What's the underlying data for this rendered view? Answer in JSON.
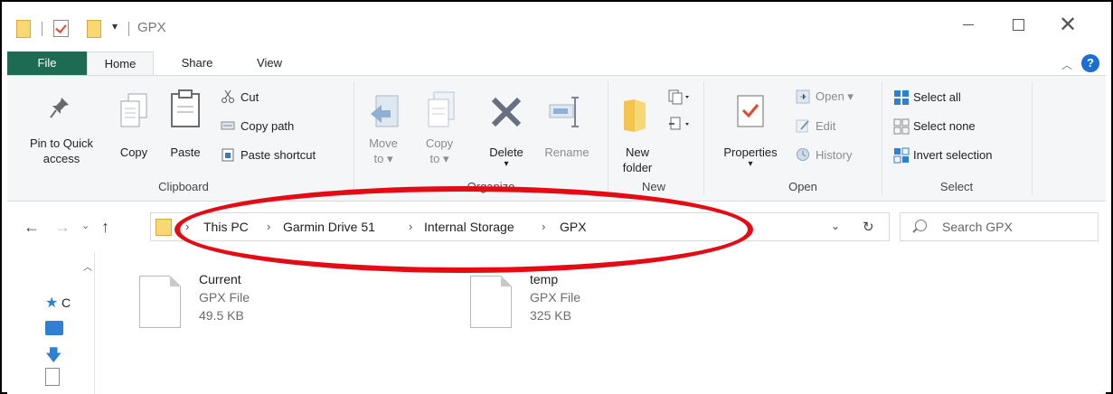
{
  "window": {
    "title": "GPX"
  },
  "tabs": {
    "file": "File",
    "home": "Home",
    "share": "Share",
    "view": "View"
  },
  "help": {
    "label": "?"
  },
  "ribbon": {
    "clipboard": {
      "label": "Clipboard",
      "pin_line1": "Pin to Quick",
      "pin_line2": "access",
      "copy": "Copy",
      "paste": "Paste",
      "cut": "Cut",
      "copy_path": "Copy path",
      "paste_shortcut": "Paste shortcut"
    },
    "organize": {
      "label": "Organize",
      "move_line1": "Move",
      "move_line2": "to ▾",
      "copy_line1": "Copy",
      "copy_line2": "to ▾",
      "delete": "Delete",
      "delete_arrow": "▾",
      "rename": "Rename"
    },
    "new": {
      "label": "New",
      "new_folder_line1": "New",
      "new_folder_line2": "folder"
    },
    "open": {
      "label": "Open",
      "properties": "Properties",
      "properties_arrow": "▾",
      "open": "Open ▾",
      "edit": "Edit",
      "history": "History"
    },
    "select": {
      "label": "Select",
      "select_all": "Select all",
      "select_none": "Select none",
      "invert_selection": "Invert selection"
    }
  },
  "address": {
    "breadcrumbs": [
      "This PC",
      "Garmin Drive 51",
      "Internal Storage",
      "GPX"
    ],
    "separator": "›"
  },
  "search": {
    "placeholder": "Search GPX"
  },
  "navpane": {
    "quick_access_partial": "C"
  },
  "files": [
    {
      "name": "Current",
      "type": "GPX File",
      "size": "49.5 KB"
    },
    {
      "name": "temp",
      "type": "GPX File",
      "size": "325 KB"
    }
  ],
  "colors": {
    "file_tab": "#1d6b52",
    "annotation": "#e40b14",
    "accent": "#1a6fd1"
  }
}
